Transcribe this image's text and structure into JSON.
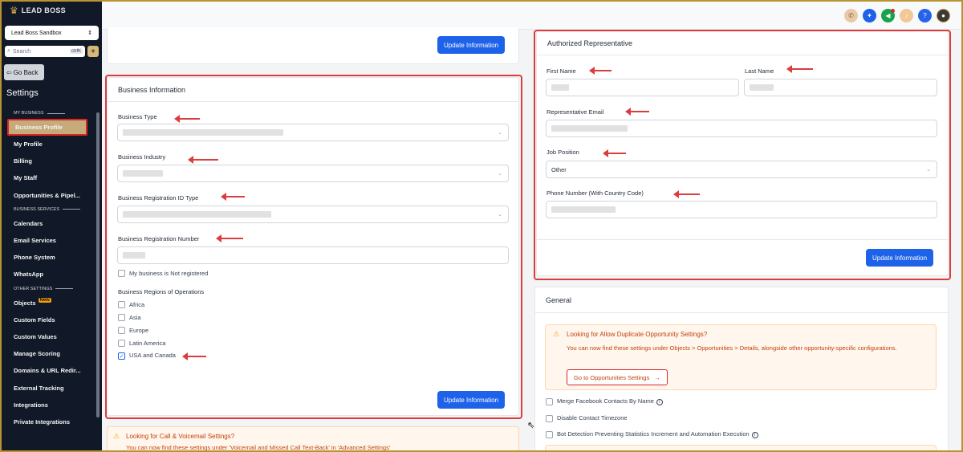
{
  "brand": {
    "name": "LEAD BOSS"
  },
  "sidebar": {
    "location": "Lead Boss Sandbox",
    "search_placeholder": "Search",
    "search_shortcut": "ctrlK",
    "go_back": "Go Back",
    "title": "Settings",
    "sections": {
      "my_business": "MY BUSINESS",
      "business_services": "BUSINESS SERVICES",
      "other_settings": "OTHER SETTINGS"
    },
    "items": [
      {
        "label": "Business Profile"
      },
      {
        "label": "My Profile"
      },
      {
        "label": "Billing"
      },
      {
        "label": "My Staff"
      },
      {
        "label": "Opportunities & Pipel..."
      },
      {
        "label": "Calendars"
      },
      {
        "label": "Email Services"
      },
      {
        "label": "Phone System"
      },
      {
        "label": "WhatsApp"
      },
      {
        "label": "Objects",
        "badge": "New"
      },
      {
        "label": "Custom Fields"
      },
      {
        "label": "Custom Values"
      },
      {
        "label": "Manage Scoring"
      },
      {
        "label": "Domains & URL Redir..."
      },
      {
        "label": "External Tracking"
      },
      {
        "label": "Integrations"
      },
      {
        "label": "Private Integrations"
      }
    ]
  },
  "topbar": {
    "icons": [
      "phone-icon",
      "magic-icon",
      "megaphone-icon",
      "bell-icon",
      "help-icon",
      "avatar"
    ],
    "help_label": "?"
  },
  "top_card": {
    "button": "Update Information"
  },
  "business_info": {
    "title": "Business Information",
    "business_type_label": "Business Type",
    "business_industry_label": "Business Industry",
    "registration_id_type_label": "Business Registration ID Type",
    "registration_number_label": "Business Registration Number",
    "not_registered_label": "My business is Not registered",
    "regions_label": "Business Regions of Operations",
    "regions": [
      {
        "label": "Africa",
        "checked": false
      },
      {
        "label": "Asia",
        "checked": false
      },
      {
        "label": "Europe",
        "checked": false
      },
      {
        "label": "Latin America",
        "checked": false
      },
      {
        "label": "USA and Canada",
        "checked": true
      }
    ],
    "button": "Update Information"
  },
  "call_warning": {
    "title": "Looking for Call & Voicemail Settings?",
    "text": "You can now find these settings under 'Voicemail and Missed Call Text-Back' in 'Advanced Settings'"
  },
  "authorized_rep": {
    "title": "Authorized Representative",
    "first_name_label": "First Name",
    "last_name_label": "Last Name",
    "email_label": "Representative Email",
    "job_position_label": "Job Position",
    "job_position_value": "Other",
    "phone_label": "Phone Number (With Country Code)",
    "button": "Update Information"
  },
  "general": {
    "title": "General",
    "warning_title": "Looking for Allow Duplicate Opportunity Settings?",
    "warning_text": "You can now find these settings under Objects > Opportunities > Details, alongside other opportunity-specific configurations.",
    "warning_button": "Go to Opportunities Settings",
    "options": [
      {
        "label": "Merge Facebook Contacts By Name",
        "info": true
      },
      {
        "label": "Disable Contact Timezone",
        "info": false
      },
      {
        "label": "Bot Detection Preventing Statistics Increment and Automation Execution",
        "info": true
      }
    ]
  },
  "colors": {
    "primary": "#1d62e8",
    "highlight": "#dc3c3c",
    "sidebar_bg": "#111827",
    "active_item": "#c7aa7a",
    "frame": "#b8932f"
  }
}
